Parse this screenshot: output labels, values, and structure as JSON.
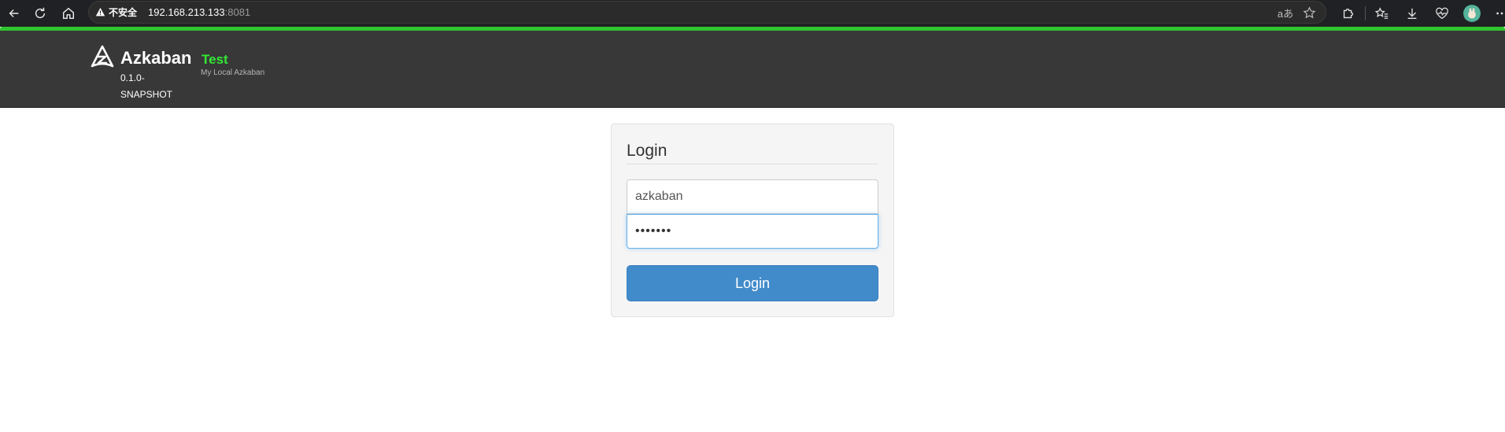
{
  "browser": {
    "security_label": "不安全",
    "url_host": "192.168.213.133",
    "url_port": ":8081",
    "read_aloud_label": "aあ"
  },
  "header": {
    "brand": "Azkaban",
    "version": "0.1.0-SNAPSHOT",
    "env_name": "Test",
    "env_description": "My Local Azkaban",
    "accent_color": "#33e833"
  },
  "login": {
    "title": "Login",
    "username_value": "azkaban",
    "password_value": "•••••••",
    "submit_label": "Login",
    "button_color": "#428bca"
  }
}
